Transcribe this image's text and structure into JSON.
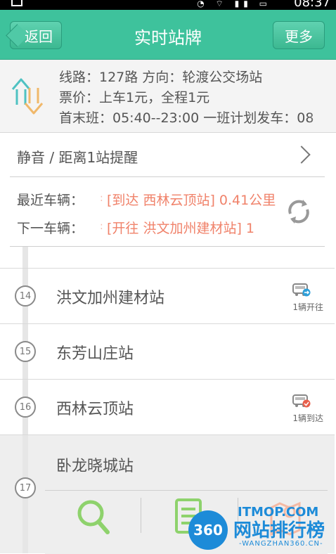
{
  "status_bar": {
    "time": "08:37",
    "signal": "3G"
  },
  "header": {
    "back_label": "返回",
    "title": "实时站牌",
    "more_label": "更多"
  },
  "route_info": {
    "line_text": "线路：127路  方向：轮渡公交场站",
    "fare_text": "票价：上车1元，全程1元",
    "schedule_text": "首末班：05:40--23:00  一班计划发车：08"
  },
  "notify": {
    "label": "静音 / 距离1站提醒"
  },
  "vehicles": {
    "nearest_label": "最近车辆：",
    "nearest_value": "[到达 西林云顶站] 0.41公里",
    "next_label": "下一车辆：",
    "next_value": "[开往 洪文加州建材站] 1"
  },
  "stops": [
    {
      "number": "14",
      "name": "洪文加州建材站",
      "bus_status": "1辆开往"
    },
    {
      "number": "15",
      "name": "东芳山庄站",
      "bus_status": ""
    },
    {
      "number": "16",
      "name": "西林云顶站",
      "bus_status": "1辆到达"
    },
    {
      "number": "17",
      "name": "卧龙晓城站",
      "bus_status": ""
    }
  ],
  "toolbar": {
    "search_icon": "search-icon",
    "document_icon": "document-icon",
    "map_icon": "map-pin-icon"
  },
  "watermark": {
    "circle_text": "360",
    "brand": "网站排行榜",
    "site": "ITMOP.COM",
    "sub": "-WANGZHAN360.CN-"
  },
  "colors": {
    "header": "#3ec29c",
    "accent_text": "#f0826a",
    "search_icon": "#8ed26c",
    "doc_icon": "#8ed26c",
    "map_icon": "#f4b9a4",
    "watermark": "#1d8bd8"
  }
}
